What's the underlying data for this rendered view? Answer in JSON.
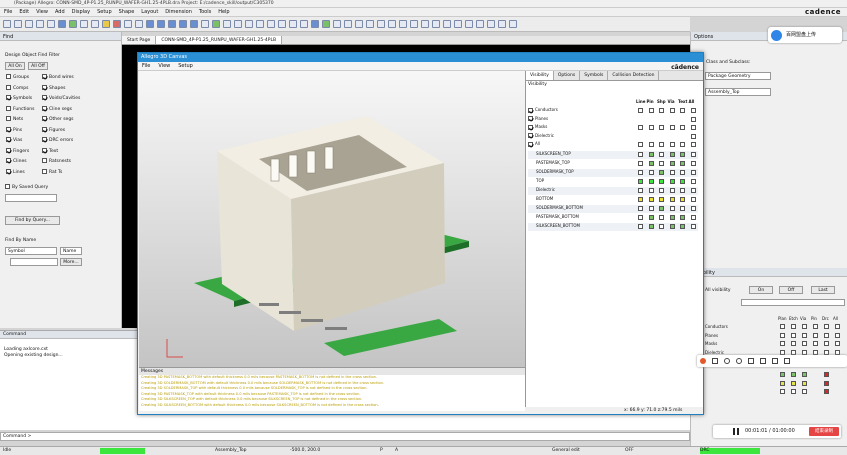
{
  "window": {
    "title": "(Package) Allegro: CONN-SMD_4P-P1.25_RUNPU_WAFER-GH1.25-4PLB.dra  Project: E:/cadence_skill/output/C305370"
  },
  "menu": [
    "File",
    "Edit",
    "View",
    "Add",
    "Display",
    "Setup",
    "Shape",
    "Layout",
    "Dimension",
    "Tools",
    "Help"
  ],
  "brand": "cadence",
  "find": {
    "header": "Find",
    "filter_title": "Design Object Find Filter",
    "all_on": "All On",
    "all_off": "All Off",
    "left_items": [
      {
        "label": "Groups",
        "on": false
      },
      {
        "label": "Comps",
        "on": false
      },
      {
        "label": "Symbols",
        "on": true
      },
      {
        "label": "Functions",
        "on": false
      },
      {
        "label": "Nets",
        "on": false
      },
      {
        "label": "Pins",
        "on": true
      },
      {
        "label": "Vias",
        "on": true
      },
      {
        "label": "Fingers",
        "on": true
      },
      {
        "label": "Clines",
        "on": true
      },
      {
        "label": "Lines",
        "on": true
      }
    ],
    "right_items": [
      {
        "label": "Bond wires",
        "on": true
      },
      {
        "label": "Shapes",
        "on": true
      },
      {
        "label": "Voids/Cavities",
        "on": true
      },
      {
        "label": "Cline segs",
        "on": true
      },
      {
        "label": "Other segs",
        "on": true
      },
      {
        "label": "Figures",
        "on": true
      },
      {
        "label": "DRC errors",
        "on": true
      },
      {
        "label": "Text",
        "on": true
      },
      {
        "label": "Ratsnests",
        "on": false
      },
      {
        "label": "Rat Ts",
        "on": false
      }
    ],
    "by_saved_query": "By Saved Query",
    "find_by_query": "Find by Query...",
    "find_by_name": "Find By Name",
    "symbol": "Symbol",
    "name": "Name",
    "more": "More..."
  },
  "tabs": [
    "Start Page",
    "CONN-SMD_4P-P1.25_RUNPU_WAFER-GH1.25-4PLB"
  ],
  "command": {
    "header": "Command",
    "lines": [
      "Loading axlcore.cxt",
      "Opening existing design..."
    ],
    "prompt": "Command >"
  },
  "status": {
    "mode": "Idle",
    "layer": "Assembly_Top",
    "coords": "-500.0, 200.0",
    "p": "P",
    "a": "A",
    "edit": "General edit",
    "off": "OFF",
    "drc": "DRC"
  },
  "options": {
    "header": "Options",
    "class_label": "Class and Subclass:",
    "class": "Package Geometry",
    "subclass": "Assembly_Top"
  },
  "vispanel": {
    "label": "Visibility",
    "all_visibility": "All visibility",
    "on": "On",
    "off": "Off",
    "last": "Last",
    "cols": [
      "Plan",
      "Etch",
      "Via",
      "Pin",
      "Drc",
      "All"
    ],
    "rows": [
      "Conductors",
      "Planes",
      "Masks",
      "Dielectric",
      "All"
    ]
  },
  "w3d": {
    "title": "Allegro 3D Canvas",
    "menu": [
      "File",
      "View",
      "Setup"
    ],
    "brand": "cādence",
    "tabs": [
      "Visibility",
      "Options",
      "Symbols",
      "Collision Detection"
    ],
    "vis_title": "Visibility",
    "cols": [
      "Line",
      "Pin",
      "Shp",
      "Via",
      "Text",
      "All"
    ],
    "groups": [
      "Conductors",
      "Planes",
      "Masks",
      "Dielectric",
      "All"
    ],
    "layers": [
      "SILKSCREEN_TOP",
      "PASTEMASK_TOP",
      "SOLDERMASK_TOP",
      "TOP",
      "Dielectric",
      "BOTTOM",
      "SOLDERMASK_BOTTOM",
      "PASTEMASK_BOTTOM",
      "SILKSCREEN_BOTTOM"
    ],
    "messages_title": "Messages",
    "messages": [
      "Creating 3D PASTEMASK_BOTTOM with default thickness 0.0 mils because PASTEMASK_BOTTOM is not defined in the cross section.",
      "Creating 3D SOLDERMASK_BOTTOM with default thickness 0.0 mils because SOLDERMASK_BOTTOM is not defined in the cross section.",
      "Creating 3D SOLDERMASK_TOP with default thickness 0.0 mils because SOLDERMASK_TOP is not defined in the cross section.",
      "Creating 3D PASTEMASK_TOP with default thickness 0.0 mils because PASTEMASK_TOP is not defined in the cross section.",
      "Creating 3D SILKSCREEN_TOP with default thickness 0.0 mils because SILKSCREEN_TOP is not defined in the cross section.",
      "Creating 3D SILKSCREEN_BOTTOM with default thickness 0.0 mils because SILKSCREEN_BOTTOM is not defined in the cross section."
    ],
    "coords": "x: 66.9  y: 71.0  z:79.5  mils"
  },
  "floatbar": {
    "cloud": "百网盟盘上传"
  },
  "recorder": {
    "time": "00:01:01 / 01:00:00",
    "stop": "结束录制"
  }
}
